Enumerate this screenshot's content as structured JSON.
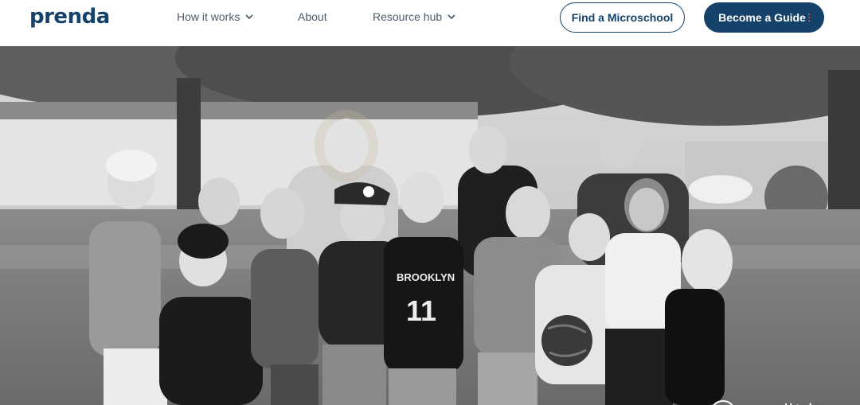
{
  "brand": {
    "logo_text": "prenda",
    "color": "#15426b"
  },
  "nav": {
    "items": [
      {
        "label": "How it works",
        "has_dropdown": true
      },
      {
        "label": "About",
        "has_dropdown": false
      },
      {
        "label": "Resource hub",
        "has_dropdown": true
      }
    ]
  },
  "actions": {
    "find_label": "Find a Microschool",
    "guide_label": "Become a Guide"
  },
  "hero": {
    "image": "black-and-white group photo of smiling children and adults in a park",
    "jersey_text": "BROOKLYN",
    "jersey_number": "11"
  },
  "watermark": {
    "text": "Edu指南",
    "icon": "wechat-icon"
  },
  "colors": {
    "primary": "#15426b",
    "accent": "#e8544b",
    "nav_text": "#4f5b6a"
  }
}
